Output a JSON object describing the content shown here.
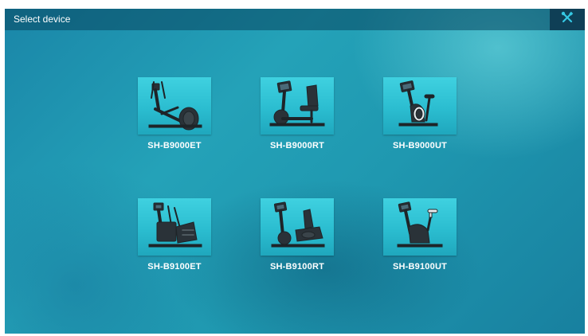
{
  "header": {
    "title": "Select device",
    "settings_icon": "tools-icon"
  },
  "devices": [
    {
      "model": "SH-B9000ET",
      "icon": "elliptical-trainer-icon"
    },
    {
      "model": "SH-B9000RT",
      "icon": "recumbent-bike-icon"
    },
    {
      "model": "SH-B9000UT",
      "icon": "upright-bike-icon"
    },
    {
      "model": "SH-B9100ET",
      "icon": "elliptical-trainer-icon"
    },
    {
      "model": "SH-B9100RT",
      "icon": "recumbent-bike-icon"
    },
    {
      "model": "SH-B9100UT",
      "icon": "upright-bike-icon"
    }
  ],
  "colors": {
    "background": "#1f98b0",
    "header_bar": "#0f3f56",
    "thumbnail": "#2bbdd0",
    "text": "#ffffff"
  }
}
